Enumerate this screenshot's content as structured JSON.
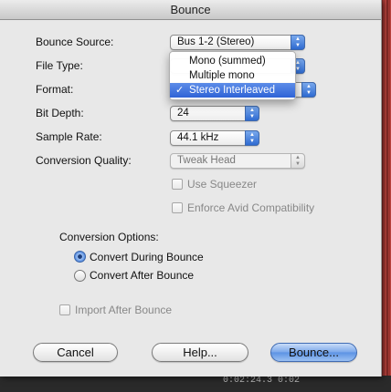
{
  "window": {
    "title": "Bounce"
  },
  "fields": {
    "bounce_source": {
      "label": "Bounce Source:",
      "value": "Bus 1-2 (Stereo)"
    },
    "file_type": {
      "label": "File Type:"
    },
    "format": {
      "label": "Format:"
    },
    "bit_depth": {
      "label": "Bit Depth:",
      "value": "24"
    },
    "sample_rate": {
      "label": "Sample Rate:",
      "value": "44.1 kHz"
    },
    "conversion_quality": {
      "label": "Conversion Quality:",
      "value": "Tweak Head"
    }
  },
  "format_menu": {
    "items": [
      {
        "label": "Mono (summed)",
        "selected": false
      },
      {
        "label": "Multiple mono",
        "selected": false
      },
      {
        "label": "Stereo Interleaved",
        "selected": true
      }
    ],
    "check_glyph": "✓"
  },
  "checkboxes": {
    "use_squeezer": {
      "label": "Use Squeezer",
      "checked": false,
      "enabled": false
    },
    "enforce_avid": {
      "label": "Enforce Avid Compatibility",
      "checked": false,
      "enabled": false
    },
    "import_after": {
      "label": "Import After Bounce",
      "checked": false,
      "enabled": false
    }
  },
  "conversion_options": {
    "label": "Conversion Options:",
    "convert_during": {
      "label": "Convert During Bounce",
      "selected": true
    },
    "convert_after": {
      "label": "Convert After Bounce",
      "selected": false
    }
  },
  "buttons": {
    "cancel": "Cancel",
    "help": "Help...",
    "bounce": "Bounce..."
  },
  "background": {
    "timestamp": "0:02:24.3 0:02"
  },
  "colors": {
    "accent": "#2f63d6",
    "waveform": "#b5423d"
  }
}
